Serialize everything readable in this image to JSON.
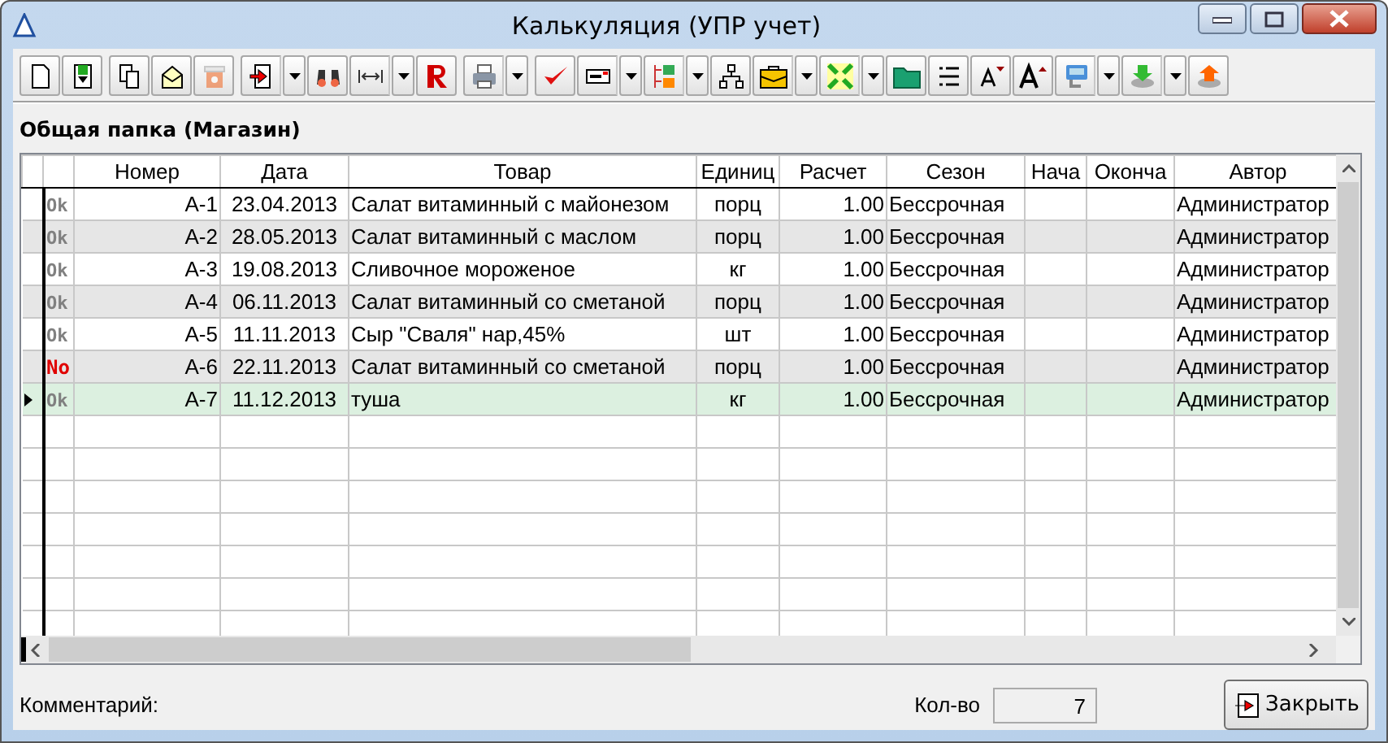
{
  "window": {
    "title": "Калькуляция (УПР учет)"
  },
  "toolbar": [
    [
      {
        "kind": "new-document",
        "menu": false,
        "disabled": false
      },
      {
        "kind": "save-document",
        "menu": false,
        "disabled": false
      }
    ],
    [
      {
        "kind": "copy",
        "menu": false,
        "disabled": false
      },
      {
        "kind": "envelope",
        "menu": false,
        "disabled": false
      },
      {
        "kind": "trash",
        "menu": false,
        "disabled": true
      }
    ],
    [
      {
        "kind": "import",
        "menu": true,
        "disabled": false
      },
      {
        "kind": "binoculars",
        "menu": false,
        "disabled": false
      },
      {
        "kind": "width",
        "menu": true,
        "disabled": false
      },
      {
        "kind": "letter-r",
        "menu": false,
        "disabled": false
      }
    ],
    [
      {
        "kind": "printer",
        "menu": true,
        "disabled": false
      }
    ],
    [
      {
        "kind": "check",
        "menu": false,
        "disabled": false
      },
      {
        "kind": "card",
        "menu": true,
        "disabled": false
      },
      {
        "kind": "columns",
        "menu": true,
        "disabled": false
      },
      {
        "kind": "hierarchy",
        "menu": false,
        "disabled": false
      },
      {
        "kind": "briefcase",
        "menu": true,
        "disabled": false
      },
      {
        "kind": "arrows",
        "menu": true,
        "disabled": false
      },
      {
        "kind": "folder",
        "menu": false,
        "disabled": false
      },
      {
        "kind": "list",
        "menu": false,
        "disabled": false
      },
      {
        "kind": "font-down",
        "menu": false,
        "disabled": false
      },
      {
        "kind": "font-up",
        "menu": false,
        "disabled": false
      },
      {
        "kind": "monitor",
        "menu": true,
        "disabled": false
      },
      {
        "kind": "disk-down",
        "menu": true,
        "disabled": false
      },
      {
        "kind": "disk-up",
        "menu": false,
        "disabled": false
      }
    ]
  ],
  "folder_label": "Общая папка (Магазин)",
  "table": {
    "columns": [
      "Номер",
      "Дата",
      "Товар",
      "Единиц",
      "Расчет",
      "Сезон",
      "Нача",
      "Оконча",
      "Автор"
    ],
    "rows": [
      {
        "status": "Ok",
        "alert": false,
        "selected": false,
        "cells": [
          "А-1",
          "23.04.2013",
          "Салат витаминный с майонезом",
          "порц",
          "1.00",
          "Бессрочная",
          "",
          "",
          "Администратор"
        ]
      },
      {
        "status": "Ok",
        "alert": false,
        "selected": false,
        "cells": [
          "А-2",
          "28.05.2013",
          "Салат витаминный с маслом",
          "порц",
          "1.00",
          "Бессрочная",
          "",
          "",
          "Администратор"
        ]
      },
      {
        "status": "Ok",
        "alert": false,
        "selected": false,
        "cells": [
          "А-3",
          "19.08.2013",
          "Сливочное мороженое",
          "кг",
          "1.00",
          "Бессрочная",
          "",
          "",
          "Администратор"
        ]
      },
      {
        "status": "Ok",
        "alert": false,
        "selected": false,
        "cells": [
          "А-4",
          "06.11.2013",
          "Салат витаминный со сметаной",
          "порц",
          "1.00",
          "Бессрочная",
          "",
          "",
          "Администратор"
        ]
      },
      {
        "status": "Ok",
        "alert": false,
        "selected": false,
        "cells": [
          "А-5",
          "11.11.2013",
          "Сыр \"Сваля\" нар,45%",
          "шт",
          "1.00",
          "Бессрочная",
          "",
          "",
          "Администратор"
        ]
      },
      {
        "status": "No",
        "alert": true,
        "selected": false,
        "cells": [
          "А-6",
          "22.11.2013",
          "Салат витаминный со сметаной",
          "порц",
          "1.00",
          "Бессрочная",
          "",
          "",
          "Администратор"
        ]
      },
      {
        "status": "Ok",
        "alert": false,
        "selected": true,
        "cells": [
          "А-7",
          "11.12.2013",
          "туша",
          "кг",
          "1.00",
          "Бессрочная",
          "",
          "",
          "Администратор"
        ]
      }
    ]
  },
  "footer": {
    "comment_label": "Комментарий:",
    "count_label": "Кол-во",
    "count_value": "7",
    "close_button": "Закрыть"
  }
}
